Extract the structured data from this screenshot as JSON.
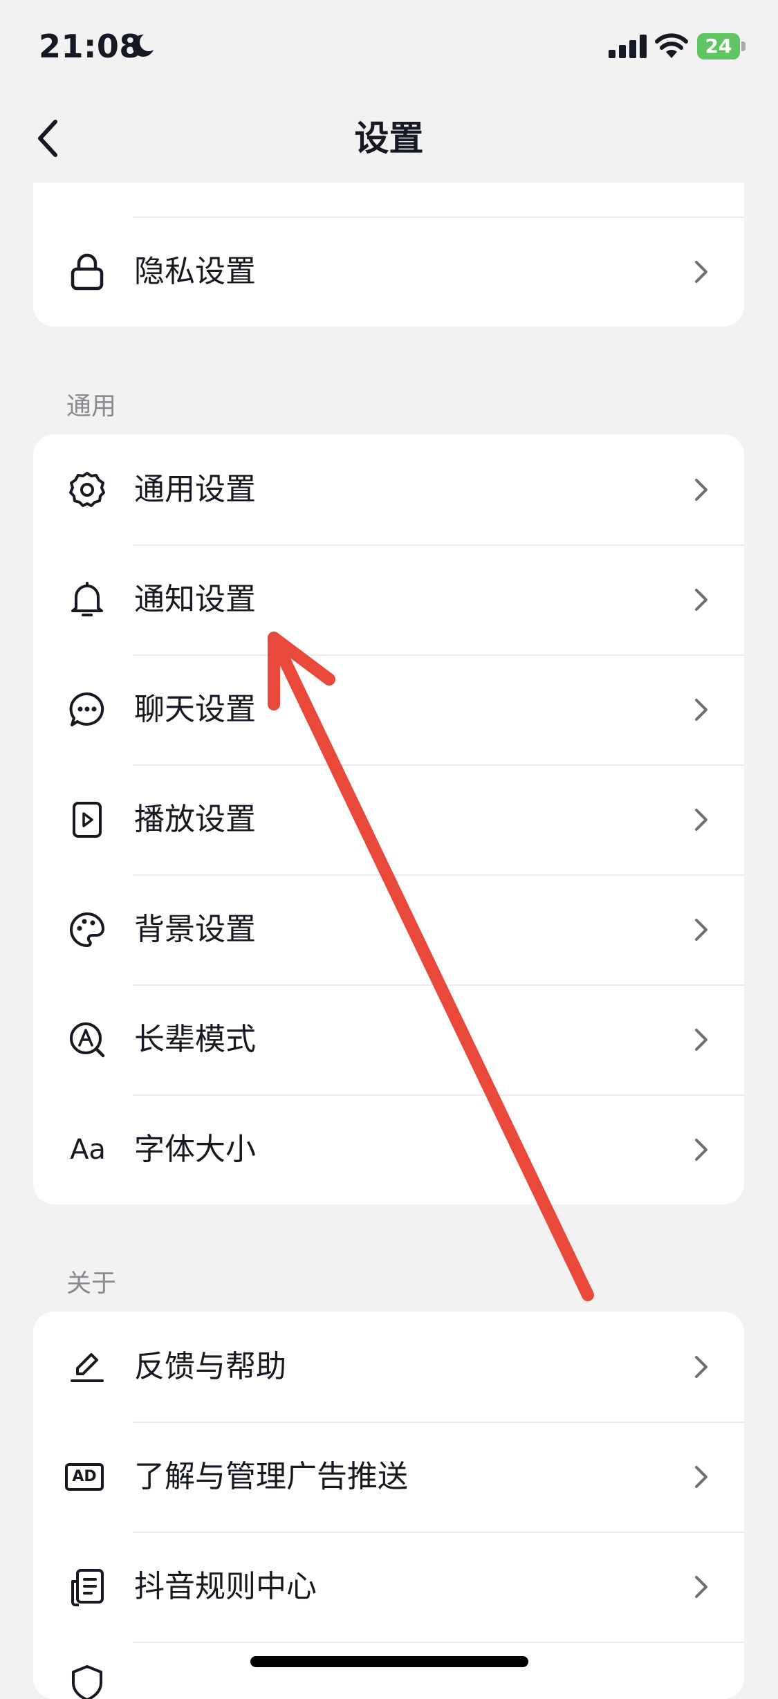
{
  "status_bar": {
    "time": "21:08",
    "battery": "24"
  },
  "nav": {
    "title": "设置"
  },
  "sections": {
    "privacy": {
      "items": [
        {
          "label": "隐私设置",
          "icon": "lock-icon"
        }
      ]
    },
    "general": {
      "title": "通用",
      "items": [
        {
          "label": "通用设置",
          "icon": "gear-icon"
        },
        {
          "label": "通知设置",
          "icon": "bell-icon"
        },
        {
          "label": "聊天设置",
          "icon": "chat-bubble-icon"
        },
        {
          "label": "播放设置",
          "icon": "play-file-icon"
        },
        {
          "label": "背景设置",
          "icon": "palette-icon"
        },
        {
          "label": "长辈模式",
          "icon": "elder-mode-icon"
        },
        {
          "label": "字体大小",
          "icon": "font-size-icon",
          "icon_text": "Aa"
        }
      ]
    },
    "about": {
      "title": "关于",
      "items": [
        {
          "label": "反馈与帮助",
          "icon": "pencil-icon"
        },
        {
          "label": "了解与管理广告推送",
          "icon": "ad-icon",
          "icon_text": "AD"
        },
        {
          "label": "抖音规则中心",
          "icon": "document-list-icon"
        }
      ]
    }
  },
  "colors": {
    "background": "#f2f2f2",
    "card": "#ffffff",
    "text": "#161823",
    "section_title": "#8a8b91",
    "annotation_arrow": "#e8493b",
    "battery": "#5fc562"
  }
}
